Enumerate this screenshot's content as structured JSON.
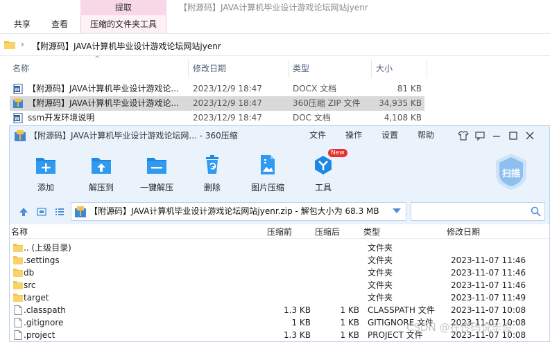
{
  "explorer": {
    "context_tab": "提取",
    "title": "【附源码】JAVA计算机毕业设计游戏论坛网站jyenr",
    "tabs": [
      "共享",
      "查看",
      "压缩的文件夹工具"
    ],
    "breadcrumb_chevron": "›",
    "path": "【附源码】JAVA计算机毕业设计游戏论坛网站jyenr",
    "columns": {
      "name": "名称",
      "modified": "修改日期",
      "type": "类型",
      "size": "大小"
    },
    "sort_glyph": "^",
    "files": [
      {
        "name": "【附源码】JAVA计算机毕业设计游戏论...",
        "modified": "2023/12/9 18:47",
        "type": "DOCX 文档",
        "size": "81 KB",
        "icon": "word-doc-icon"
      },
      {
        "name": "【附源码】JAVA计算机毕业设计游戏论...",
        "modified": "2023/12/9 18:47",
        "type": "360压缩 ZIP 文件",
        "size": "34,935 KB",
        "icon": "zip-archive-icon"
      },
      {
        "name": "ssm开发环境说明",
        "modified": "2023/12/9 18:47",
        "type": "DOC 文档",
        "size": "4,108 KB",
        "icon": "word-doc-icon"
      }
    ]
  },
  "zip": {
    "title": "【附源码】JAVA计算机毕业设计游戏论坛网... - 360压缩",
    "menu": [
      "文件",
      "操作",
      "设置",
      "帮助"
    ],
    "toolbar": [
      {
        "label": "添加",
        "icon": "add-icon"
      },
      {
        "label": "解压到",
        "icon": "extract-to-icon"
      },
      {
        "label": "一键解压",
        "icon": "quick-extract-icon"
      },
      {
        "label": "删除",
        "icon": "delete-icon"
      },
      {
        "label": "图片压缩",
        "icon": "image-compress-icon"
      },
      {
        "label": "工具",
        "icon": "tools-icon",
        "badge": "New"
      }
    ],
    "scan_label": "扫描",
    "path": "【附源码】JAVA计算机毕业设计游戏论坛网站jyenr.zip - 解包大小为 68.3 MB",
    "search_placeholder": "",
    "columns": {
      "name": "名称",
      "compressed": "压缩前",
      "after": "压缩后",
      "type": "类型",
      "modified": "修改日期"
    },
    "rows": [
      {
        "name": ".. (上级目录)",
        "before": "",
        "after": "",
        "type": "文件夹",
        "modified": "",
        "icon": "folder-icon"
      },
      {
        "name": ".settings",
        "before": "",
        "after": "",
        "type": "文件夹",
        "modified": "2023-11-07 11:46",
        "icon": "folder-icon"
      },
      {
        "name": "db",
        "before": "",
        "after": "",
        "type": "文件夹",
        "modified": "2023-11-07 11:46",
        "icon": "folder-icon"
      },
      {
        "name": "src",
        "before": "",
        "after": "",
        "type": "文件夹",
        "modified": "2023-11-07 11:46",
        "icon": "folder-icon"
      },
      {
        "name": "target",
        "before": "",
        "after": "",
        "type": "文件夹",
        "modified": "2023-11-07 11:49",
        "icon": "folder-icon"
      },
      {
        "name": ".classpath",
        "before": "1.3 KB",
        "after": "1 KB",
        "type": "CLASSPATH 文件",
        "modified": "2023-11-07 10:08",
        "icon": "file-icon"
      },
      {
        "name": ".gitignore",
        "before": "1 KB",
        "after": "1 KB",
        "type": "GITIGNORE 文件",
        "modified": "2023-11-07 10:08",
        "icon": "file-icon"
      },
      {
        "name": ".project",
        "before": "1.3 KB",
        "after": "1 KB",
        "type": "PROJECT 文件",
        "modified": "2023-11-07 10:08",
        "icon": "file-icon"
      }
    ]
  },
  "watermark": "CSDN @在传码说毕设",
  "colors": {
    "accent": "#1e88e5",
    "folder": "#f5c44e",
    "context_tab": "#f8d7e6"
  }
}
